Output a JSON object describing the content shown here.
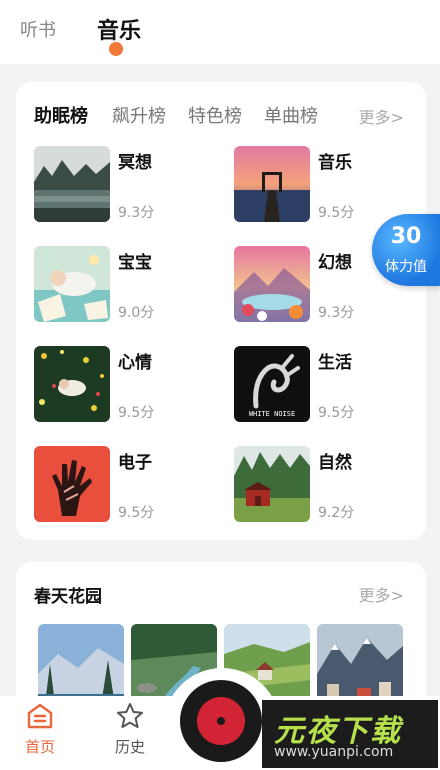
{
  "header": {
    "tabs": [
      {
        "label": "听书",
        "active": false
      },
      {
        "label": "音乐",
        "active": true
      }
    ],
    "accent_color": "#ef7a3a"
  },
  "ranking": {
    "tabs": [
      {
        "label": "助眠榜",
        "active": true
      },
      {
        "label": "飙升榜",
        "active": false
      },
      {
        "label": "特色榜",
        "active": false
      },
      {
        "label": "单曲榜",
        "active": false
      }
    ],
    "more_label": "更多>",
    "items": [
      {
        "title": "冥想",
        "score": "9.3分",
        "image": "misty-lake"
      },
      {
        "title": "音乐",
        "score": "9.5分",
        "image": "sunset-pier"
      },
      {
        "title": "宝宝",
        "score": "9.0分",
        "image": "sleeping-baby"
      },
      {
        "title": "幻想",
        "score": "9.3分",
        "image": "fantasy-landscape"
      },
      {
        "title": "心情",
        "score": "9.5分",
        "image": "flower-field"
      },
      {
        "title": "生活",
        "score": "9.5分",
        "image": "white-noise-hand"
      },
      {
        "title": "电子",
        "score": "9.5分",
        "image": "red-hand"
      },
      {
        "title": "自然",
        "score": "9.2分",
        "image": "red-barn"
      }
    ]
  },
  "stamina": {
    "value": "30",
    "label": "体力值",
    "color": "#1f78e0"
  },
  "garden": {
    "title": "春天花园",
    "more_label": "更多>",
    "images": [
      "forest-lake",
      "river-valley",
      "village-fields",
      "mountain-town"
    ]
  },
  "white_noise_text": "WHITE NOISE",
  "bottom_nav": {
    "items": [
      {
        "label": "首页",
        "icon": "home-icon",
        "active": true
      },
      {
        "label": "历史",
        "icon": "star-icon",
        "active": false
      }
    ],
    "player_icon": "record-disc-icon",
    "active_color": "#e8673a"
  },
  "watermark": {
    "logo": "元夜下载",
    "url": "www.yuanpi.com"
  }
}
